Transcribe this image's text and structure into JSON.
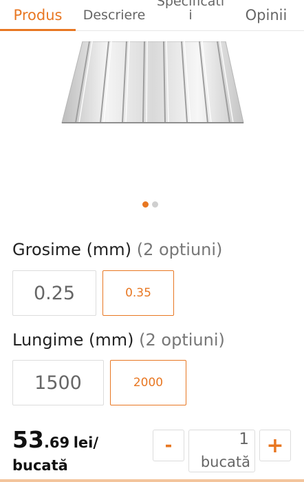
{
  "tabs": [
    {
      "label": "Produs"
    },
    {
      "label": "Descriere"
    },
    {
      "label": "Specificati\ni"
    },
    {
      "label": "Opinii"
    }
  ],
  "colors": {
    "accent": "#e87722",
    "border": "#dcdcdc"
  },
  "gallery": {
    "active_index": 0,
    "count": 2
  },
  "thickness": {
    "title": "Grosime (mm)",
    "count": "(2 optiuni)",
    "options": [
      "0.25",
      "0.35"
    ],
    "selected": "0.35"
  },
  "length": {
    "title": "Lungime (mm)",
    "count": "(2 optiuni)",
    "options": [
      "1500",
      "2000"
    ],
    "selected": "2000"
  },
  "price": {
    "integer": "53",
    "decimal": ".69",
    "currency": "lei/",
    "unit": "bucată"
  },
  "quantity": {
    "minus_label": "-",
    "plus_label": "+",
    "value": "1",
    "unit": "bucată"
  }
}
